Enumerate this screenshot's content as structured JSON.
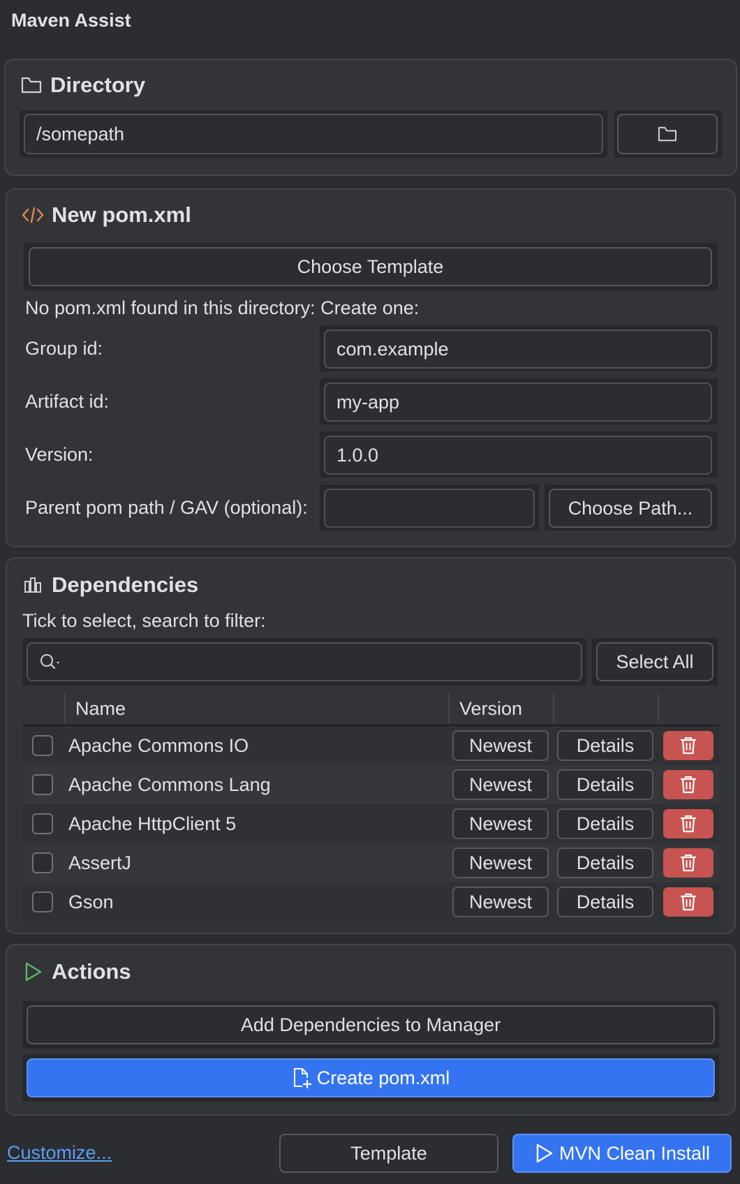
{
  "app": {
    "title": "Maven Assist"
  },
  "directory": {
    "heading": "Directory",
    "path_value": "/somepath",
    "browse_icon": "folder-icon"
  },
  "new_pom": {
    "heading": "New pom.xml",
    "choose_template_label": "Choose Template",
    "notice": "No pom.xml found in this directory: Create one:",
    "group_label": "Group id:",
    "group_value": "com.example",
    "artifact_label": "Artifact id:",
    "artifact_value": "my-app",
    "version_label": "Version:",
    "version_value": "1.0.0",
    "parent_label": "Parent pom path / GAV (optional):",
    "parent_value": "",
    "choose_path_label": "Choose Path..."
  },
  "dependencies": {
    "heading": "Dependencies",
    "hint": "Tick to select, search to filter:",
    "search_value": "",
    "select_all_label": "Select All",
    "columns": {
      "name": "Name",
      "version": "Version"
    },
    "rows": [
      {
        "name": "Apache Commons IO",
        "checked": false,
        "version_label": "Newest",
        "details_label": "Details"
      },
      {
        "name": "Apache Commons Lang",
        "checked": false,
        "version_label": "Newest",
        "details_label": "Details"
      },
      {
        "name": "Apache HttpClient 5",
        "checked": false,
        "version_label": "Newest",
        "details_label": "Details"
      },
      {
        "name": "AssertJ",
        "checked": false,
        "version_label": "Newest",
        "details_label": "Details"
      },
      {
        "name": "Gson",
        "checked": false,
        "version_label": "Newest",
        "details_label": "Details"
      }
    ]
  },
  "actions": {
    "heading": "Actions",
    "add_to_manager_label": "Add Dependencies to Manager",
    "create_pom_label": "Create pom.xml"
  },
  "footer": {
    "customize_label": "Customize...",
    "template_label": "Template",
    "mvn_install_label": "MVN Clean Install"
  },
  "colors": {
    "background": "#2b2d30",
    "panel": "#323438",
    "primary": "#3574f0",
    "danger": "#c75450",
    "link": "#589df6",
    "xml_icon": "#e0894f",
    "play_icon": "#5fb865"
  }
}
